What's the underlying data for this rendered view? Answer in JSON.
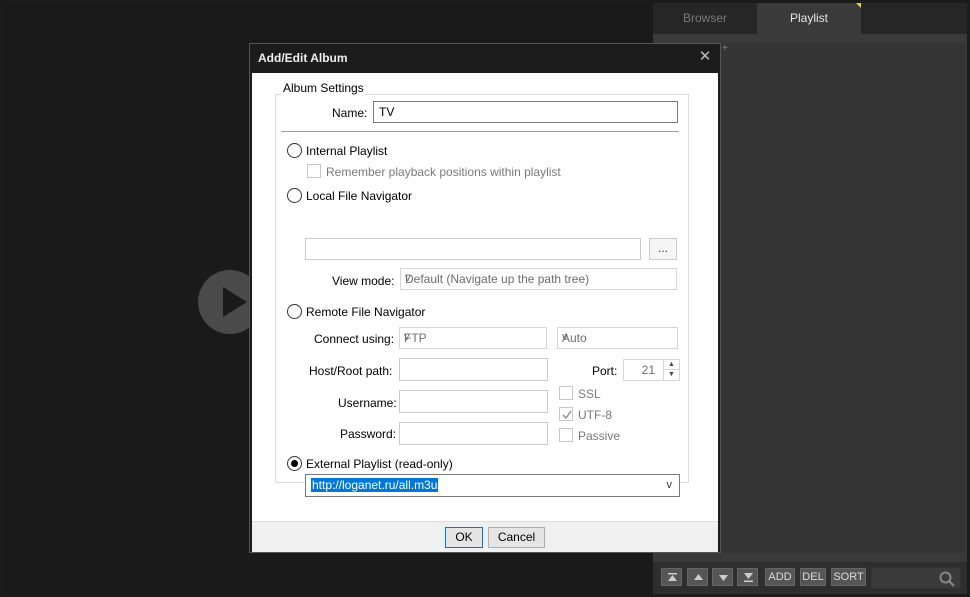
{
  "panel": {
    "tabs": [
      {
        "label": "Browser"
      },
      {
        "label": "Playlist"
      }
    ],
    "plus": "+",
    "buttons": {
      "add": "ADD",
      "del": "DEL",
      "sort": "SORT"
    }
  },
  "dialog": {
    "title": "Add/Edit Album",
    "close": "✕",
    "group_title": "Album Settings",
    "name_label": "Name:",
    "name_value": "TV",
    "internal_playlist": "Internal Playlist",
    "remember_positions": "Remember playback positions within playlist",
    "local_navigator": "Local File Navigator",
    "local_path": "",
    "browse": "...",
    "view_mode_label": "View mode:",
    "view_mode_value": "Default (Navigate up the path tree)",
    "remote_navigator": "Remote File Navigator",
    "connect_using_label": "Connect using:",
    "protocol_value": "FTP",
    "mode_value": "Auto",
    "host_label": "Host/Root path:",
    "port_label": "Port:",
    "port_value": "21",
    "username_label": "Username:",
    "password_label": "Password:",
    "ssl": "SSL",
    "utf8": "UTF-8",
    "passive": "Passive",
    "external_playlist": "External Playlist (read-only)",
    "url_value": "http://loganet.ru/all.m3u",
    "combo_arrow": "v",
    "ok": "OK",
    "cancel": "Cancel"
  }
}
